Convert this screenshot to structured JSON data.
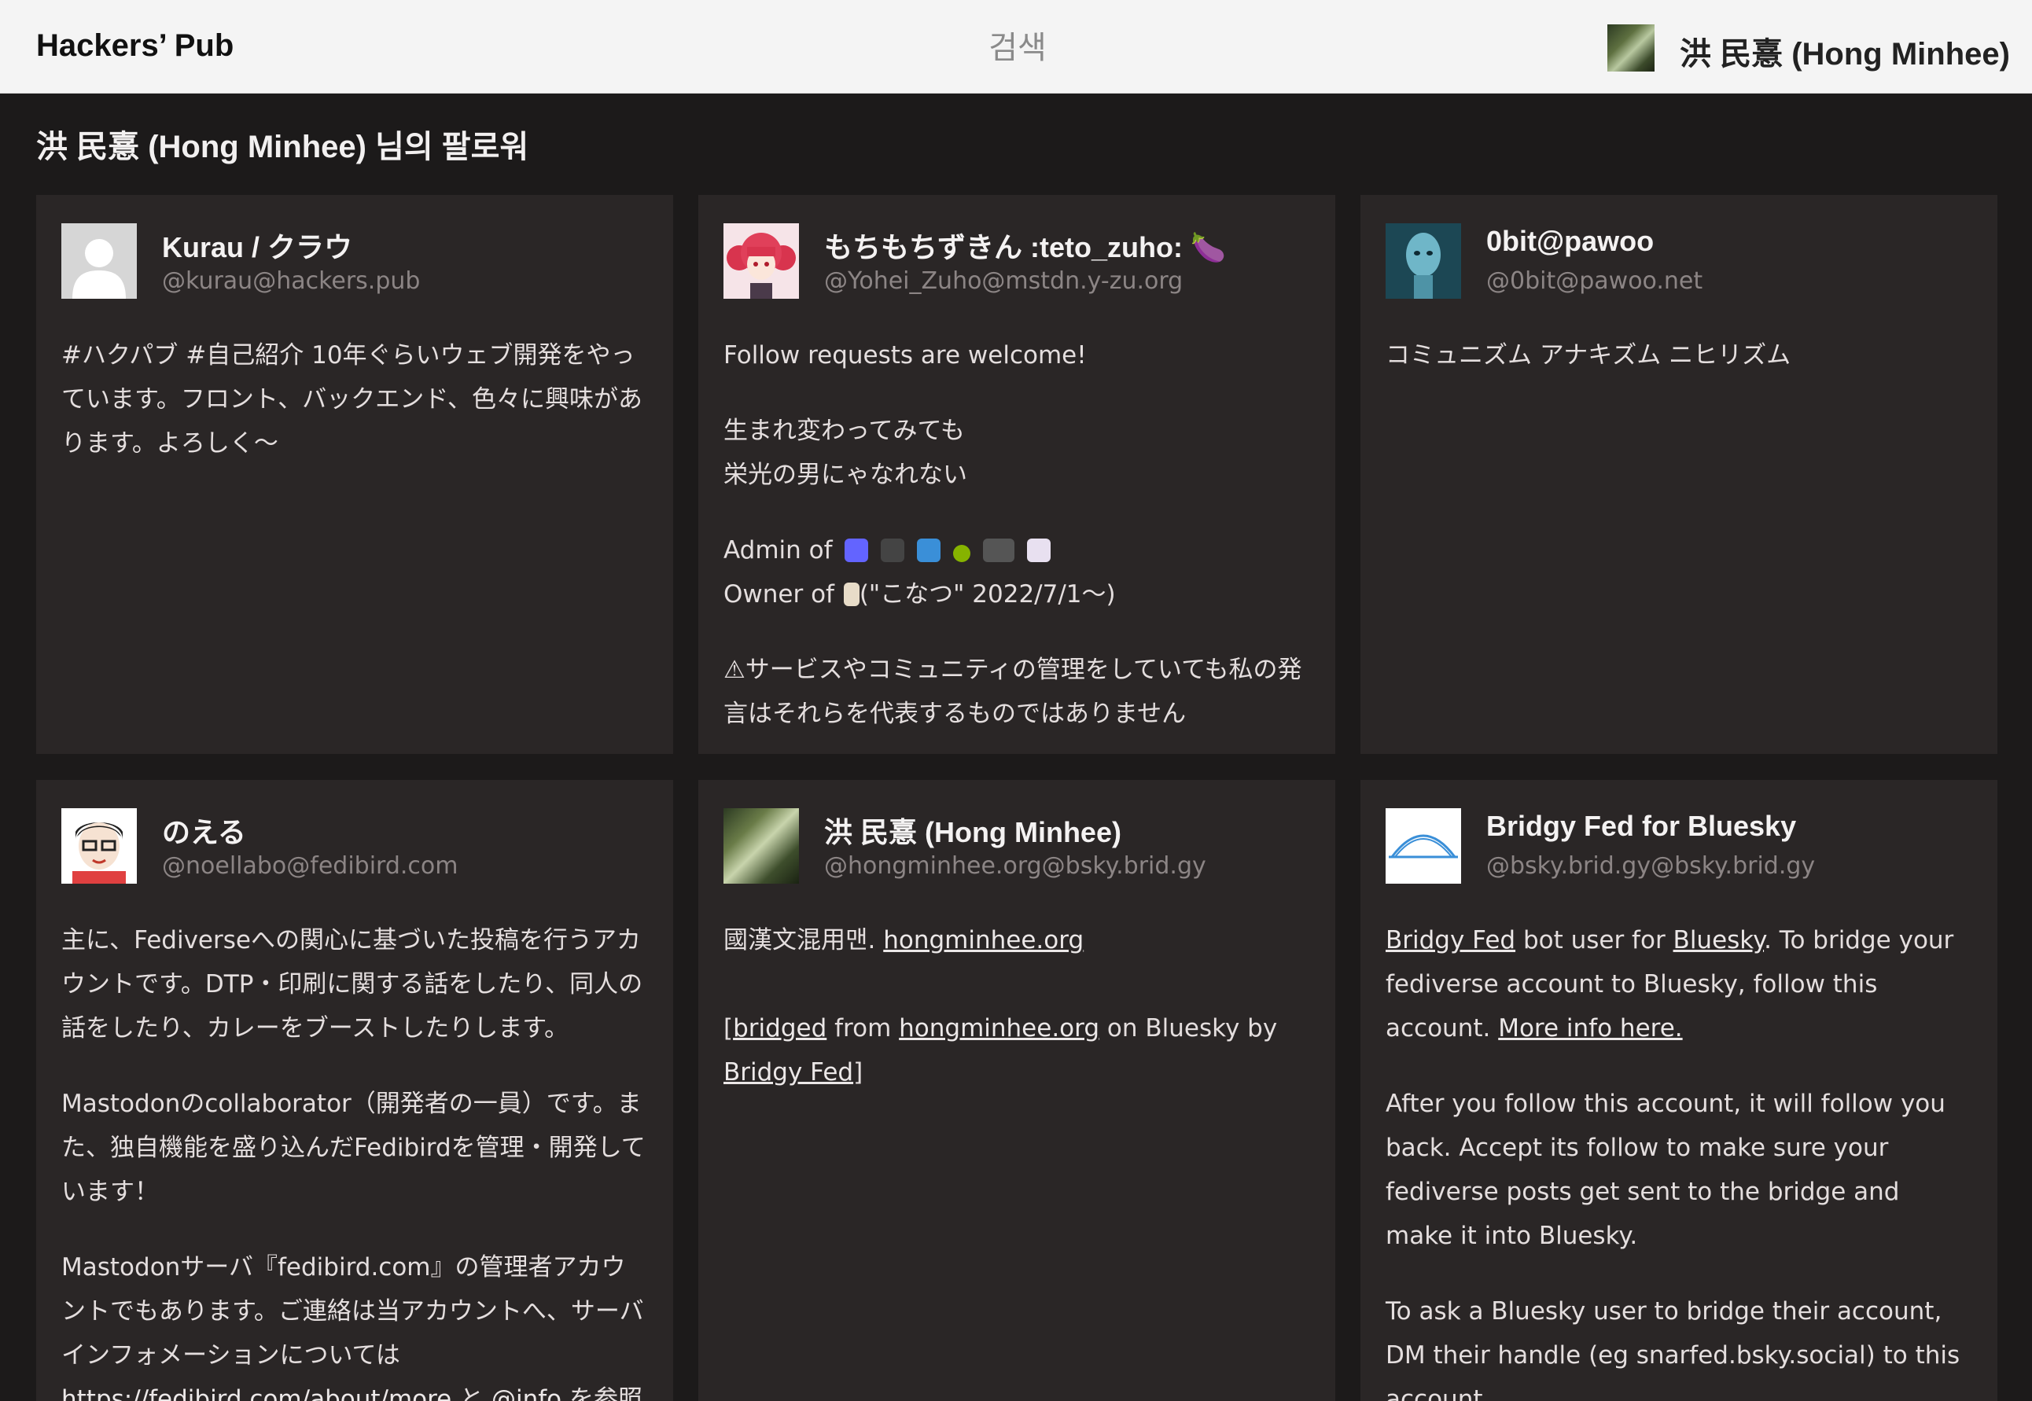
{
  "header": {
    "brand": "Hackers’ Pub",
    "search_placeholder": "검색",
    "user_name": "洪 民憙 (Hong Minhee)"
  },
  "page_title": "洪 民憙 (Hong Minhee) 님의 팔로워",
  "followers": [
    {
      "name": "Kurau / クラウ",
      "handle": "@kurau@hackers.pub",
      "bio": [
        "#ハクパブ #自己紹介 10年ぐらいウェブ開発をやっています。フロント、バックエンド、色々に興味があります。よろしく〜"
      ]
    },
    {
      "name": "もちもちずきん :teto_zuho:",
      "name_emoji": "🍆",
      "handle": "@Yohei_Zuho@mstdn.y-zu.org",
      "bio_p1": "Follow requests are welcome!",
      "bio_p2a": "生まれ変わってみても",
      "bio_p2b": "栄光の男にゃなれない",
      "bio_p3a": "Admin of",
      "bio_p3b": "Owner of",
      "bio_p3c": "(\"こなつ\" 2022/7/1〜)",
      "bio_p4": "⚠サービスやコミュニティの管理をしていても私の発言はそれらを代表するものではありません"
    },
    {
      "name": "0bit@pawoo",
      "handle": "@0bit@pawoo.net",
      "bio": [
        "コミュニズム アナキズム ニヒリズム"
      ]
    },
    {
      "name": "のえる",
      "handle": "@noellabo@fedibird.com",
      "bio_p1": "主に、Fediverseへの関心に基づいた投稿を行うアカウントです。DTP・印刷に関する話をしたり、同人の話をしたり、カレーをブーストしたりします。",
      "bio_p2": "Mastodonのcollaborator（開発者の一員）です。また、独自機能を盛り込んだFedibirdを管理・開発しています！",
      "bio_p3a": "Mastodonサーバ『fedibird.com』の管理者アカウントでもあります。ご連絡は当アカウントへ、サーバインフォメーションについては",
      "bio_p3_link1": "https://fedibird.com/about/more",
      "bio_p3b": "と",
      "bio_p3_link2": "@info",
      "bio_p3c": "を参照してくだ"
    },
    {
      "name": "洪 民憙 (Hong Minhee)",
      "handle": "@hongminhee.org@bsky.brid.gy",
      "bio_p1a": "國漢文混用맨.",
      "bio_p1_link": "hongminhee.org",
      "bio_p2_open": "[",
      "bio_p2_link1": "bridged",
      "bio_p2a": "from",
      "bio_p2_link2": "hongminhee.org",
      "bio_p2b": "on Bluesky by",
      "bio_p2_link3": "Bridgy Fed",
      "bio_p2_close": "]"
    },
    {
      "name": "Bridgy Fed for Bluesky",
      "handle": "@bsky.brid.gy@bsky.brid.gy",
      "bio_p1_link1": "Bridgy Fed",
      "bio_p1a": "bot user for",
      "bio_p1_link2": "Bluesky",
      "bio_p1b": ". To bridge your fediverse account to Bluesky, follow this account.",
      "bio_p1_link3": "More info here.",
      "bio_p2": "After you follow this account, it will follow you back. Accept its follow to make sure your fediverse posts get sent to the bridge and make it into Bluesky.",
      "bio_p3": "To ask a Bluesky user to bridge their account, DM their handle (eg snarfed.bsky.social) to this account."
    }
  ]
}
